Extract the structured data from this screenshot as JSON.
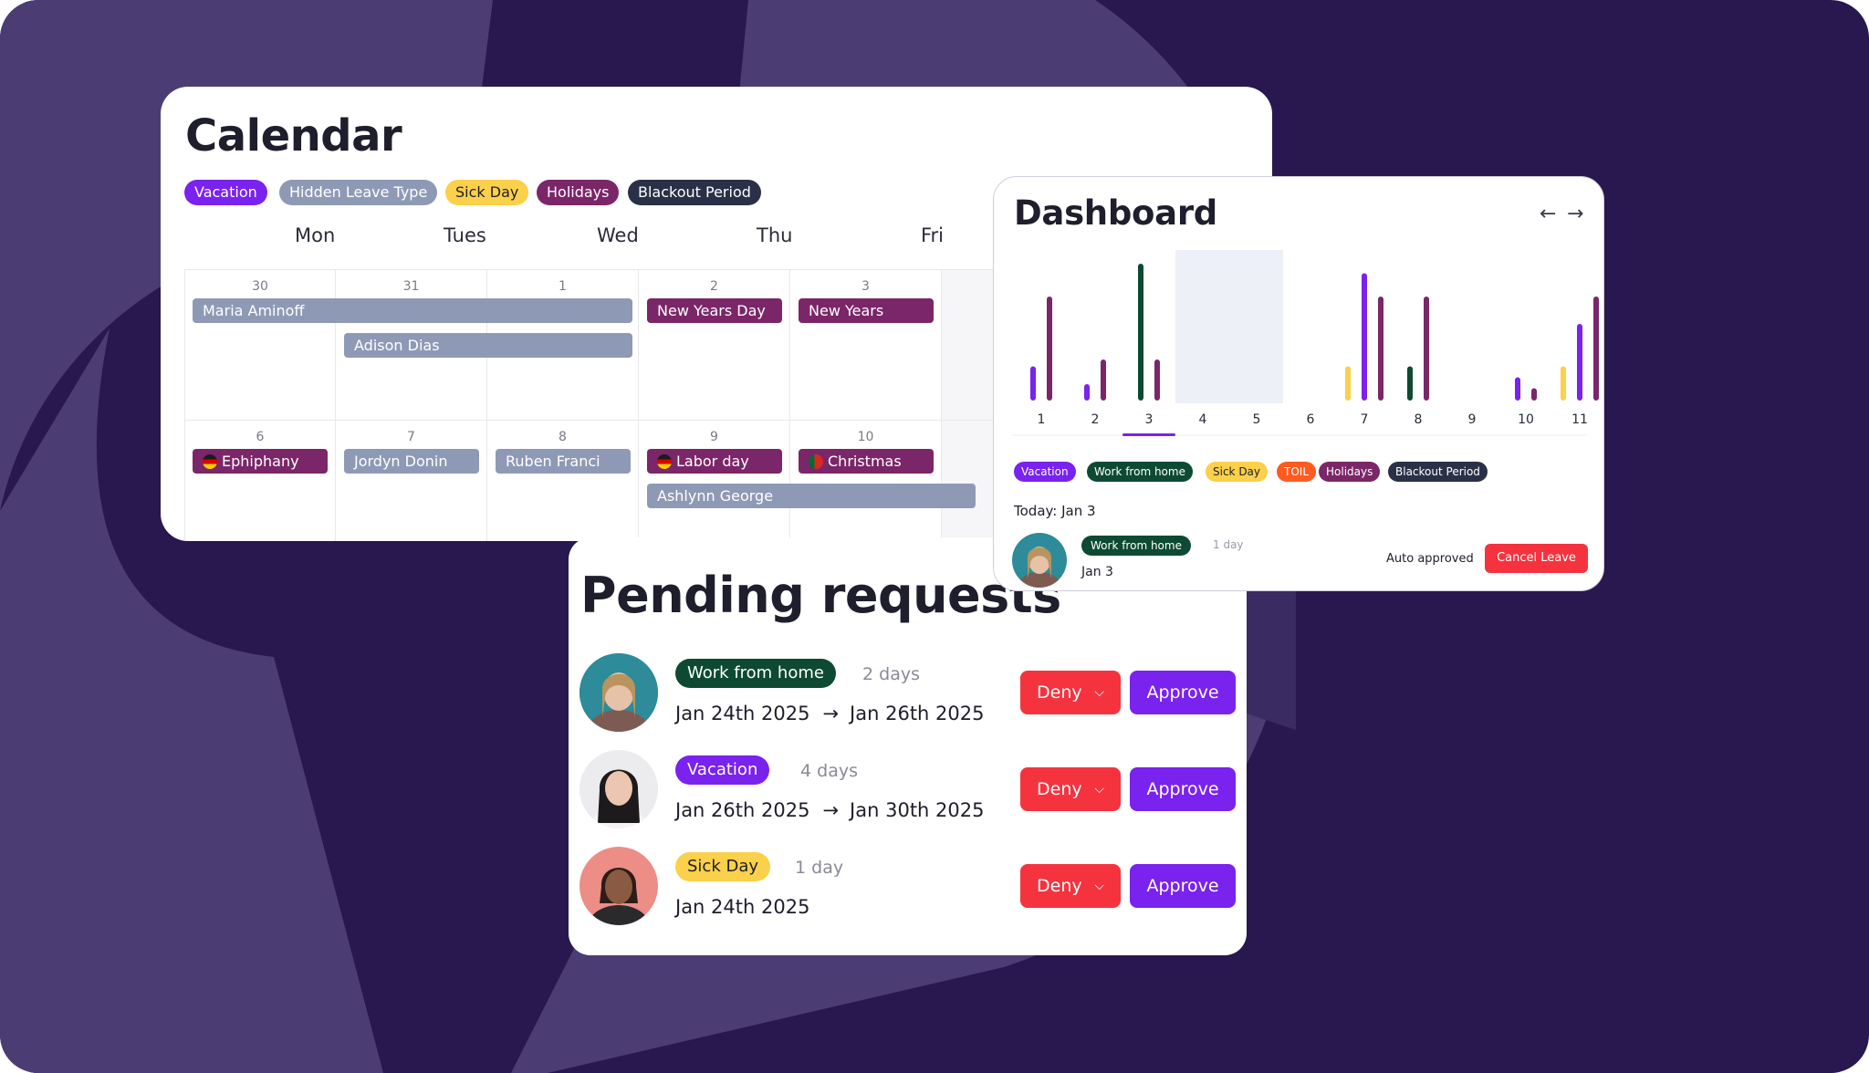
{
  "colors": {
    "background": "#29174f",
    "vacation": "#7a22ee",
    "hidden_leave_type": "#8e9ab5",
    "sick_day": "#fbd04a",
    "holidays": "#7b2668",
    "blackout": "#2a3047",
    "work_from_home": "#0e4a33",
    "toil": "#ff5a1f",
    "deny": "#f5333f",
    "approve": "#7a22ee"
  },
  "calendar": {
    "title": "Calendar",
    "legend": [
      "Vacation",
      "Hidden Leave Type",
      "Sick Day",
      "Holidays",
      "Blackout Period"
    ],
    "weekdays": [
      "Mon",
      "Tues",
      "Wed",
      "Thu",
      "Fri"
    ],
    "weeks": [
      {
        "days": [
          "30",
          "31",
          "1",
          "2",
          "3"
        ],
        "events": [
          "Maria Aminoff",
          "Adison Dias",
          "New Years Day",
          "New Years"
        ]
      },
      {
        "days": [
          "6",
          "7",
          "8",
          "9",
          "10"
        ],
        "events": [
          "Ephiphany",
          "Jordyn Donin",
          "Ruben Franci",
          "Labor day",
          "Christmas",
          "Ashlynn George"
        ]
      }
    ]
  },
  "pending": {
    "title": "Pending requests",
    "deny_label": "Deny",
    "approve_label": "Approve",
    "requests": [
      {
        "type": "Work from home",
        "duration": "2 days",
        "start": "Jan 24th 2025",
        "end": "Jan 26th 2025"
      },
      {
        "type": "Vacation",
        "duration": "4 days",
        "start": "Jan 26th 2025",
        "end": "Jan 30th 2025"
      },
      {
        "type": "Sick Day",
        "duration": "1 day",
        "start": "Jan 24th 2025",
        "end": ""
      }
    ]
  },
  "dashboard": {
    "title": "Dashboard",
    "prev_icon": "arrow-left-icon",
    "next_icon": "arrow-right-icon",
    "legend": [
      "Vacation",
      "Work from home",
      "Sick Day",
      "TOIL",
      "Holidays",
      "Blackout Period"
    ],
    "today_label": "Today: Jan 3",
    "today_entry": {
      "type": "Work from home",
      "duration": "1 day",
      "date": "Jan 3",
      "status": "Auto approved",
      "cancel_label": "Cancel Leave"
    }
  },
  "chart_data": {
    "type": "bar",
    "categories": [
      "1",
      "2",
      "3",
      "4",
      "5",
      "6",
      "7",
      "8",
      "9",
      "10",
      "11"
    ],
    "selected_category": "3",
    "highlighted_category": "4",
    "ylim": [
      0,
      10
    ],
    "series": [
      {
        "name": "Sick Day",
        "color": "#fbd04a",
        "values": [
          0,
          0,
          0,
          0,
          0,
          0,
          2.5,
          0,
          0,
          0,
          2.5
        ]
      },
      {
        "name": "Work from home",
        "color": "#0e4a33",
        "values": [
          0,
          0,
          10,
          0,
          0,
          0,
          0,
          2.5,
          0,
          0,
          0
        ]
      },
      {
        "name": "Vacation",
        "color": "#7a22ee",
        "values": [
          2.5,
          1.2,
          0,
          0,
          0,
          0,
          9.3,
          0,
          0,
          1.7,
          5.6
        ]
      },
      {
        "name": "Holidays",
        "color": "#7b2668",
        "values": [
          7.6,
          3.0,
          3.0,
          0,
          0,
          0,
          7.6,
          7.6,
          0,
          0.9,
          7.6
        ]
      }
    ]
  }
}
